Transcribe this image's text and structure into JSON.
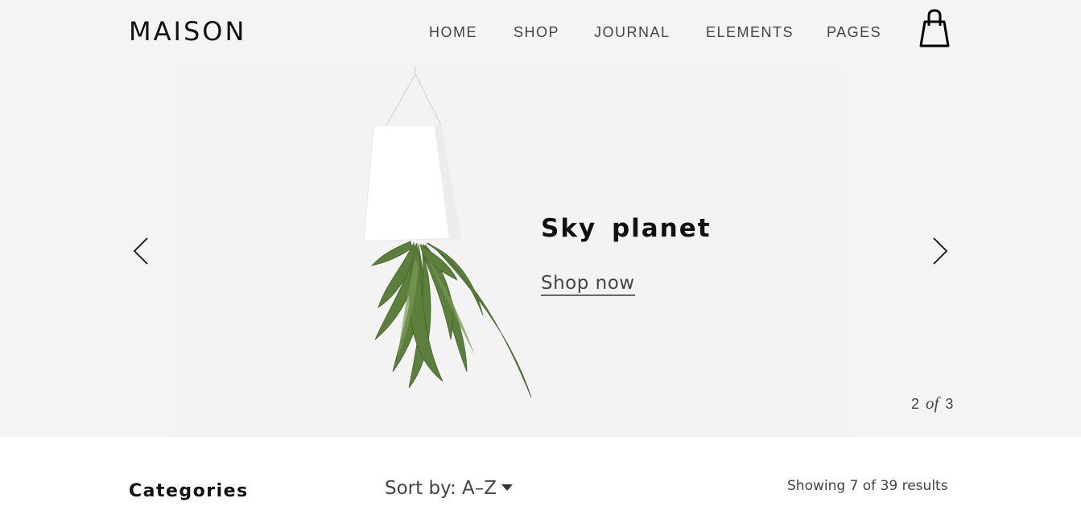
{
  "header": {
    "logo": "MAISON",
    "nav": [
      {
        "label": "HOME"
      },
      {
        "label": "SHOP"
      },
      {
        "label": "JOURNAL"
      },
      {
        "label": "ELEMENTS"
      },
      {
        "label": "PAGES"
      }
    ],
    "cart_icon": "shopping-bag-icon"
  },
  "hero": {
    "title": "Sky  planet",
    "cta": "Shop now",
    "prev_icon": "chevron-left-icon",
    "next_icon": "chevron-right-icon",
    "counter": {
      "current": "2",
      "of": "of",
      "total": "3"
    },
    "image_icon": "hanging-plant-image"
  },
  "shop": {
    "categories_heading": "Categories",
    "sort_label": "Sort by: A–Z",
    "results_text": "Showing 7 of 39 results"
  },
  "colors": {
    "hero_bg": "#f4f4f4",
    "text_dark": "#111111",
    "text_muted": "#444444"
  }
}
